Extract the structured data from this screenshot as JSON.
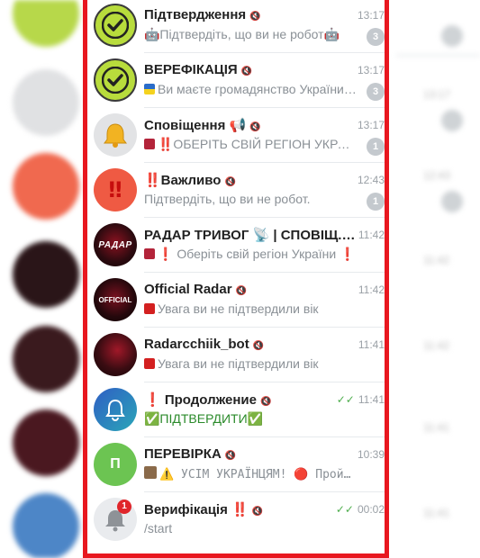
{
  "chats": [
    {
      "title": "Підтвердження",
      "time": "13:17",
      "preview": "🤖Підтвердіть, що ви не робот🤖",
      "unread": "3",
      "avatar": "check-green"
    },
    {
      "title": "ВЕРЕФІКАЦІЯ",
      "time": "13:17",
      "preview": "Ви маєте громадянство України⁉️",
      "unread": "3",
      "avatar": "check-green"
    },
    {
      "title": "Сповіщення 📢",
      "time": "13:17",
      "preview": "‼️ОБЕРІТЬ СВІЙ РЕГІОН УКРАЇН...",
      "unread": "1",
      "avatar": "bell-grey"
    },
    {
      "title": "‼️Важливо",
      "time": "12:43",
      "preview": "Підтвердіть, що ви не робот.",
      "unread": "1",
      "avatar": "exclaim-red"
    },
    {
      "title": "РАДАР ТРИВОГ 📡 | СПОВІЩ...",
      "time": "11:42",
      "preview": "❗ Оберіть свій регіон України ❗",
      "unread": "",
      "avatar": "radar-dark",
      "avatar_text": "РАДАР"
    },
    {
      "title": "Official Radar",
      "time": "11:42",
      "preview": "Увага ви не підтвердили вік",
      "unread": "",
      "avatar": "radar-dark",
      "avatar_text": "OFFICIAL"
    },
    {
      "title": "Radarcchiik_bot",
      "time": "11:41",
      "preview": "Увага ви не підтвердили вік",
      "unread": "",
      "avatar": "radar-dark",
      "avatar_text": ""
    },
    {
      "title": "❗ Продолжение",
      "time": "11:41",
      "preview": "✅ПІДТВЕРДИТИ✅",
      "unread": "",
      "avatar": "bell-blue",
      "read": true
    },
    {
      "title": "ПЕРЕВІРКА",
      "time": "10:39",
      "preview": "⚠️ УСІМ УКРАЇНЦЯМ! 🔴 Пройдіть...",
      "unread": "",
      "avatar": "letter-green",
      "avatar_letter": "П"
    },
    {
      "title": "Верифікація ‼️",
      "time": "00:02",
      "preview": "/start",
      "unread": "",
      "avatar": "bell-notify",
      "read": true,
      "avatar_badge": "1"
    }
  ],
  "colors": {
    "frame": "#e8171f",
    "accent_green": "#4fae4e",
    "badge": "#c4c9ce"
  }
}
